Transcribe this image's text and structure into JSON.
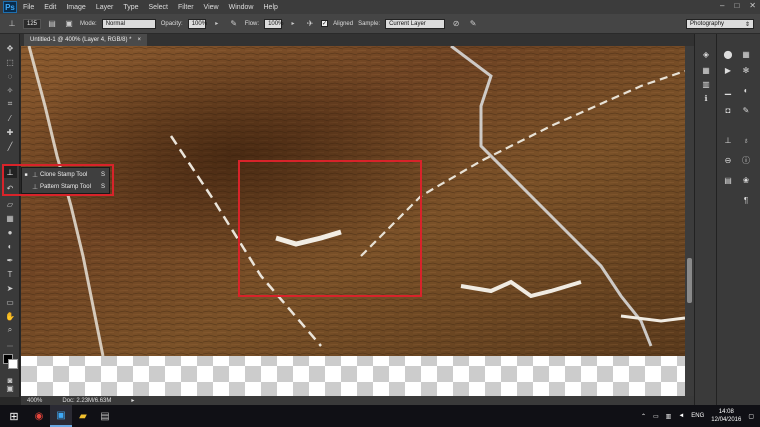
{
  "app": {
    "logo": "Ps"
  },
  "menu": [
    "File",
    "Edit",
    "Image",
    "Layer",
    "Type",
    "Select",
    "Filter",
    "View",
    "Window",
    "Help"
  ],
  "window_controls": [
    "–",
    "□",
    "✕"
  ],
  "options": {
    "brush_size": "125",
    "mode_label": "Mode:",
    "mode_value": "Normal",
    "opacity_label": "Opacity:",
    "opacity_value": "100%",
    "flow_label": "Flow:",
    "flow_value": "100%",
    "aligned_label": "Aligned",
    "sample_label": "Sample:",
    "sample_value": "Current Layer",
    "workspace": "Photography"
  },
  "document": {
    "tab_title": "Untitled-1 @ 400% (Layer 4, RGB/8) *",
    "close": "×"
  },
  "status": {
    "zoom": "400%",
    "doc_size": "Doc: 2.23M/6.63M"
  },
  "flyout": {
    "items": [
      {
        "label": "Clone Stamp Tool",
        "key": "S",
        "selected": true
      },
      {
        "label": "Pattern Stamp Tool",
        "key": "S",
        "selected": false
      }
    ]
  },
  "taskbar": {
    "language": "ENG",
    "time": "14:08",
    "date": "12/04/2016"
  },
  "colors": {
    "highlight_red": "#d8232a",
    "ps_blue": "#3fa9f5",
    "foreground": "#000000",
    "background": "#ffffff"
  }
}
